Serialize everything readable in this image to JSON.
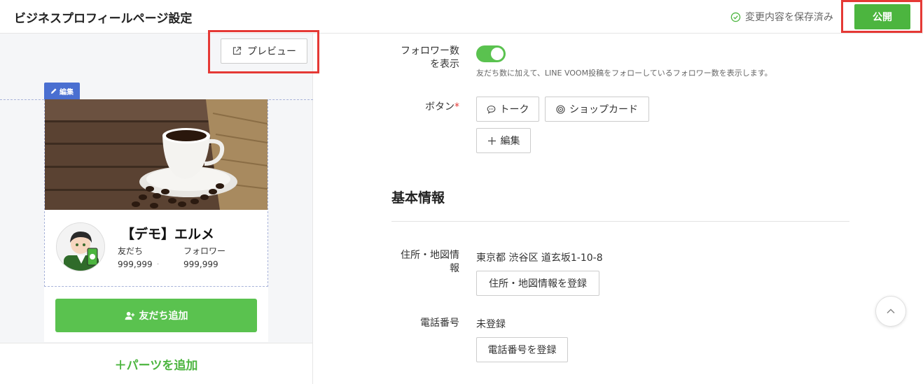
{
  "header": {
    "title": "ビジネスプロフィールページ設定",
    "saved_status": "変更内容を保存済み",
    "publish_label": "公開"
  },
  "preview": {
    "preview_label": "プレビュー",
    "edit_tag": "編集",
    "account_name": "【デモ】エルメ",
    "friends_label": "友だち",
    "friends_value": "999,999",
    "followers_label": "フォロワー",
    "followers_value": "999,999",
    "add_friend_label": "友だち追加",
    "add_parts_label": "＋パーツを追加"
  },
  "settings": {
    "follower_count": {
      "label_line1": "フォロワー数",
      "label_line2": "を表示",
      "enabled": true,
      "help": "友だち数に加えて、LINE VOOM投稿をフォローしているフォロワー数を表示します。"
    },
    "buttons": {
      "label": "ボタン",
      "required_mark": "*",
      "talk_label": "トーク",
      "shopcard_label": "ショップカード",
      "edit_label": "編集"
    },
    "basic_info": {
      "section_title": "基本情報",
      "address_label_line1": "住所・地図情",
      "address_label_line2": "報",
      "address_value": "東京都 渋谷区 道玄坂1-10-8",
      "address_button": "住所・地図情報を登録",
      "phone_label": "電話番号",
      "phone_value": "未登録",
      "phone_button": "電話番号を登録"
    }
  },
  "colors": {
    "brand_green": "#4cb53f",
    "highlight_red": "#e53935",
    "edit_blue": "#4a6fd1"
  }
}
